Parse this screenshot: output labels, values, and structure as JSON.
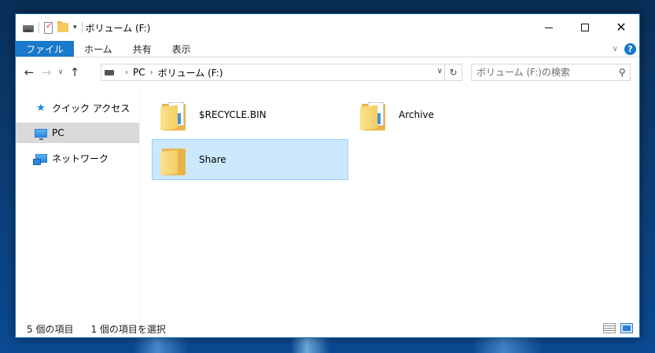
{
  "window": {
    "title": "ボリューム (F:)"
  },
  "title_controls": {
    "minimize_label": "",
    "maximize_label": "",
    "close_label": "✕"
  },
  "ribbon": {
    "tabs": [
      {
        "label": "ファイル"
      },
      {
        "label": "ホーム"
      },
      {
        "label": "共有"
      },
      {
        "label": "表示"
      }
    ],
    "help_label": "?"
  },
  "address": {
    "crumbs": [
      "PC",
      "ボリューム (F:)"
    ]
  },
  "search": {
    "placeholder": "ボリューム (F:)の検索"
  },
  "nav_pane": {
    "items": [
      {
        "label": "クイック アクセス",
        "icon": "star-icon"
      },
      {
        "label": "PC",
        "icon": "computer-icon"
      },
      {
        "label": "ネットワーク",
        "icon": "network-icon"
      }
    ]
  },
  "content": {
    "items": [
      {
        "name": "$RECYCLE.BIN",
        "icon": "folder-icon"
      },
      {
        "name": "Archive",
        "icon": "folder-icon"
      },
      {
        "name": "Share",
        "icon": "folder-icon",
        "selected": true
      }
    ]
  },
  "status": {
    "item_count": "5 個の項目",
    "selected_count": "1 個の項目を選択"
  },
  "colors": {
    "accent": "#1979ca",
    "selection": "#cce8ff",
    "selection_border": "#99d1ff"
  }
}
